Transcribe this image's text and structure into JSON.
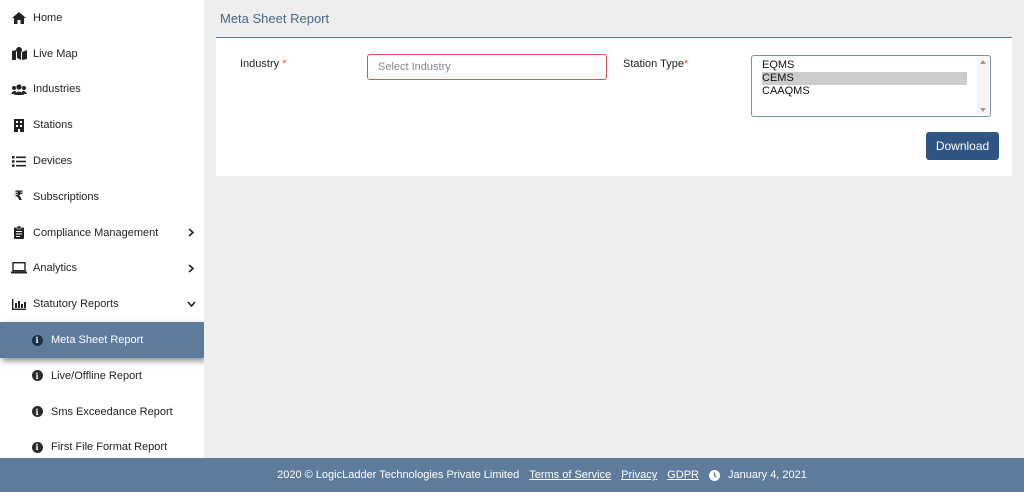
{
  "sidebar": {
    "items": [
      {
        "label": "Home",
        "icon": "home-icon"
      },
      {
        "label": "Live Map",
        "icon": "map-icon"
      },
      {
        "label": "Industries",
        "icon": "users-icon"
      },
      {
        "label": "Stations",
        "icon": "building-icon"
      },
      {
        "label": "Devices",
        "icon": "list-icon"
      },
      {
        "label": "Subscriptions",
        "icon": "rupee-icon"
      },
      {
        "label": "Compliance Management",
        "icon": "clipboard-icon",
        "expand": "chevron-right-icon"
      },
      {
        "label": "Analytics",
        "icon": "laptop-icon",
        "expand": "chevron-right-icon"
      },
      {
        "label": "Statutory Reports",
        "icon": "bar-chart-icon",
        "expand": "chevron-down-icon"
      }
    ],
    "sub_items": [
      {
        "label": "Meta Sheet Report",
        "icon": "info-icon",
        "active": true
      },
      {
        "label": "Live/Offline Report",
        "icon": "info-icon"
      },
      {
        "label": "Sms Exceedance Report",
        "icon": "info-icon"
      },
      {
        "label": "First File Format Report",
        "icon": "info-icon"
      }
    ]
  },
  "page": {
    "title": "Meta Sheet Report"
  },
  "form": {
    "industry_label": "Industry",
    "required_mark": "*",
    "industry_placeholder": "Select Industry",
    "station_type_label": "Station Type",
    "station_type_options": [
      "EQMS",
      "CEMS",
      "CAAQMS"
    ],
    "station_type_selected": "CEMS",
    "download_label": "Download"
  },
  "footer": {
    "copyright": "2020 © LogicLadder Technologies Private Limited",
    "links": [
      "Terms of Service",
      "Privacy",
      "GDPR"
    ],
    "date": "January 4, 2021"
  },
  "colors": {
    "accent": "#5f7b9b",
    "button": "#2f5583",
    "required": "#d9534f"
  }
}
